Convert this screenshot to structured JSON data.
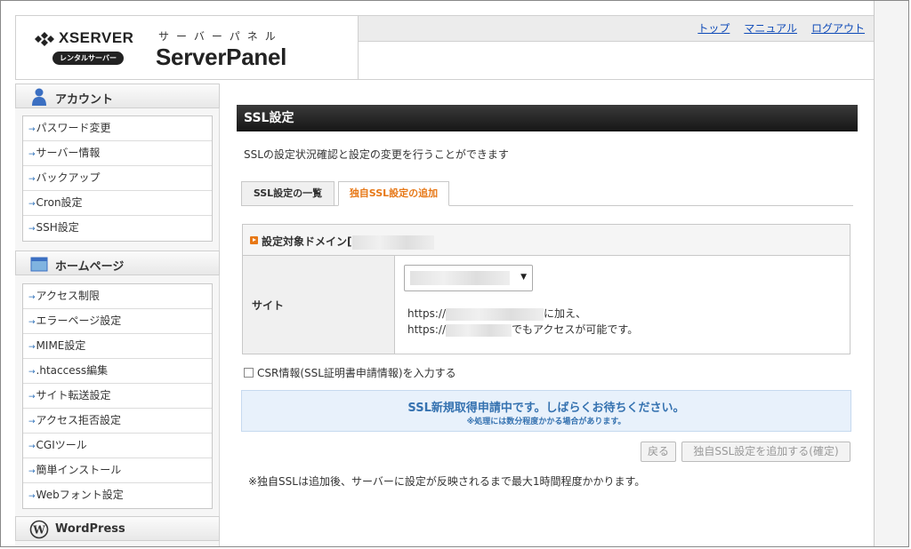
{
  "header": {
    "logo_brand": "XSERVER",
    "logo_badge": "レンタルサーバー",
    "logo_kana": "サーバーパネル",
    "logo_product": "ServerPanel",
    "nav": [
      "トップ",
      "マニュアル",
      "ログアウト"
    ]
  },
  "sidebar": {
    "sections": [
      {
        "title": "アカウント",
        "icon": "user-icon",
        "items": [
          "パスワード変更",
          "サーバー情報",
          "バックアップ",
          "Cron設定",
          "SSH設定"
        ]
      },
      {
        "title": "ホームページ",
        "icon": "window-icon",
        "items": [
          "アクセス制限",
          "エラーページ設定",
          "MIME設定",
          ".htaccess編集",
          "サイト転送設定",
          "アクセス拒否設定",
          "CGIツール",
          "簡単インストール",
          "Webフォント設定"
        ]
      },
      {
        "title": "WordPress",
        "icon": "wordpress-icon",
        "items": []
      }
    ]
  },
  "main": {
    "title": "SSL設定",
    "description": "SSLの設定状況確認と設定の変更を行うことができます",
    "tabs": [
      {
        "label": "SSL設定の一覧",
        "active": false
      },
      {
        "label": "独自SSL設定の追加",
        "active": true
      }
    ],
    "form": {
      "domain_label": "設定対象ドメイン[",
      "site_label": "サイト",
      "url1_prefix": "https://",
      "url1_suffix": "に加え、",
      "url2_prefix": "https://",
      "url2_suffix": "でもアクセスが可能です。"
    },
    "csr_label": "CSR情報(SSL証明書申請情報)を入力する",
    "csr_checked": false,
    "notice_main": "SSL新規取得申請中です。しばらくお待ちください。",
    "notice_sub": "※処理には数分程度かかる場合があります。",
    "back_label": "戻る",
    "confirm_label": "独自SSL設定を追加する(確定)",
    "footnote": "※独自SSLは追加後、サーバーに設定が反映されるまで最大1時間程度かかります。"
  },
  "colors": {
    "accent_orange": "#e77817",
    "link_blue": "#0e4ab8",
    "notice_blue": "#3572b0",
    "title_bar": "#1e1e1e"
  }
}
